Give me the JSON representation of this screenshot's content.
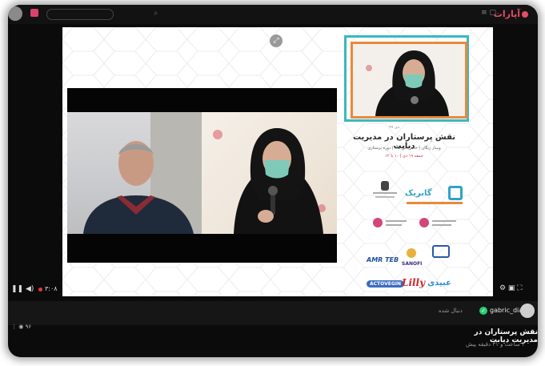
{
  "top": {
    "search_icon": "search-icon",
    "title": "",
    "logo": "آپارات"
  },
  "slide": {
    "date": "دی ۹۹",
    "title": "نقش پرستاران در مدیریت دیابت",
    "subtitle": "وبینار زنگان | خانم دکتر مانا | دوره پرستاری",
    "schedule": "جمعه ۱۹ دی | ۱۰ تا ۱۲",
    "brand": "گابریک",
    "sponsors": {
      "amrteb": "AMR TEB",
      "sanofi": "SANOFI",
      "actovegin": "ACTOVEGIN",
      "lilly": "Lilly",
      "abidi": "عبیدی"
    }
  },
  "player": {
    "live_label": "۳:۰۸",
    "views": "۹۶"
  },
  "channel": {
    "name": "gabric_dia",
    "subtitle": "دنبال شده"
  },
  "video": {
    "title": "نقش پرستاران در مدیریت دیابت",
    "meta": "۳ ساعت و ۳۱ دقیقه پیش"
  }
}
